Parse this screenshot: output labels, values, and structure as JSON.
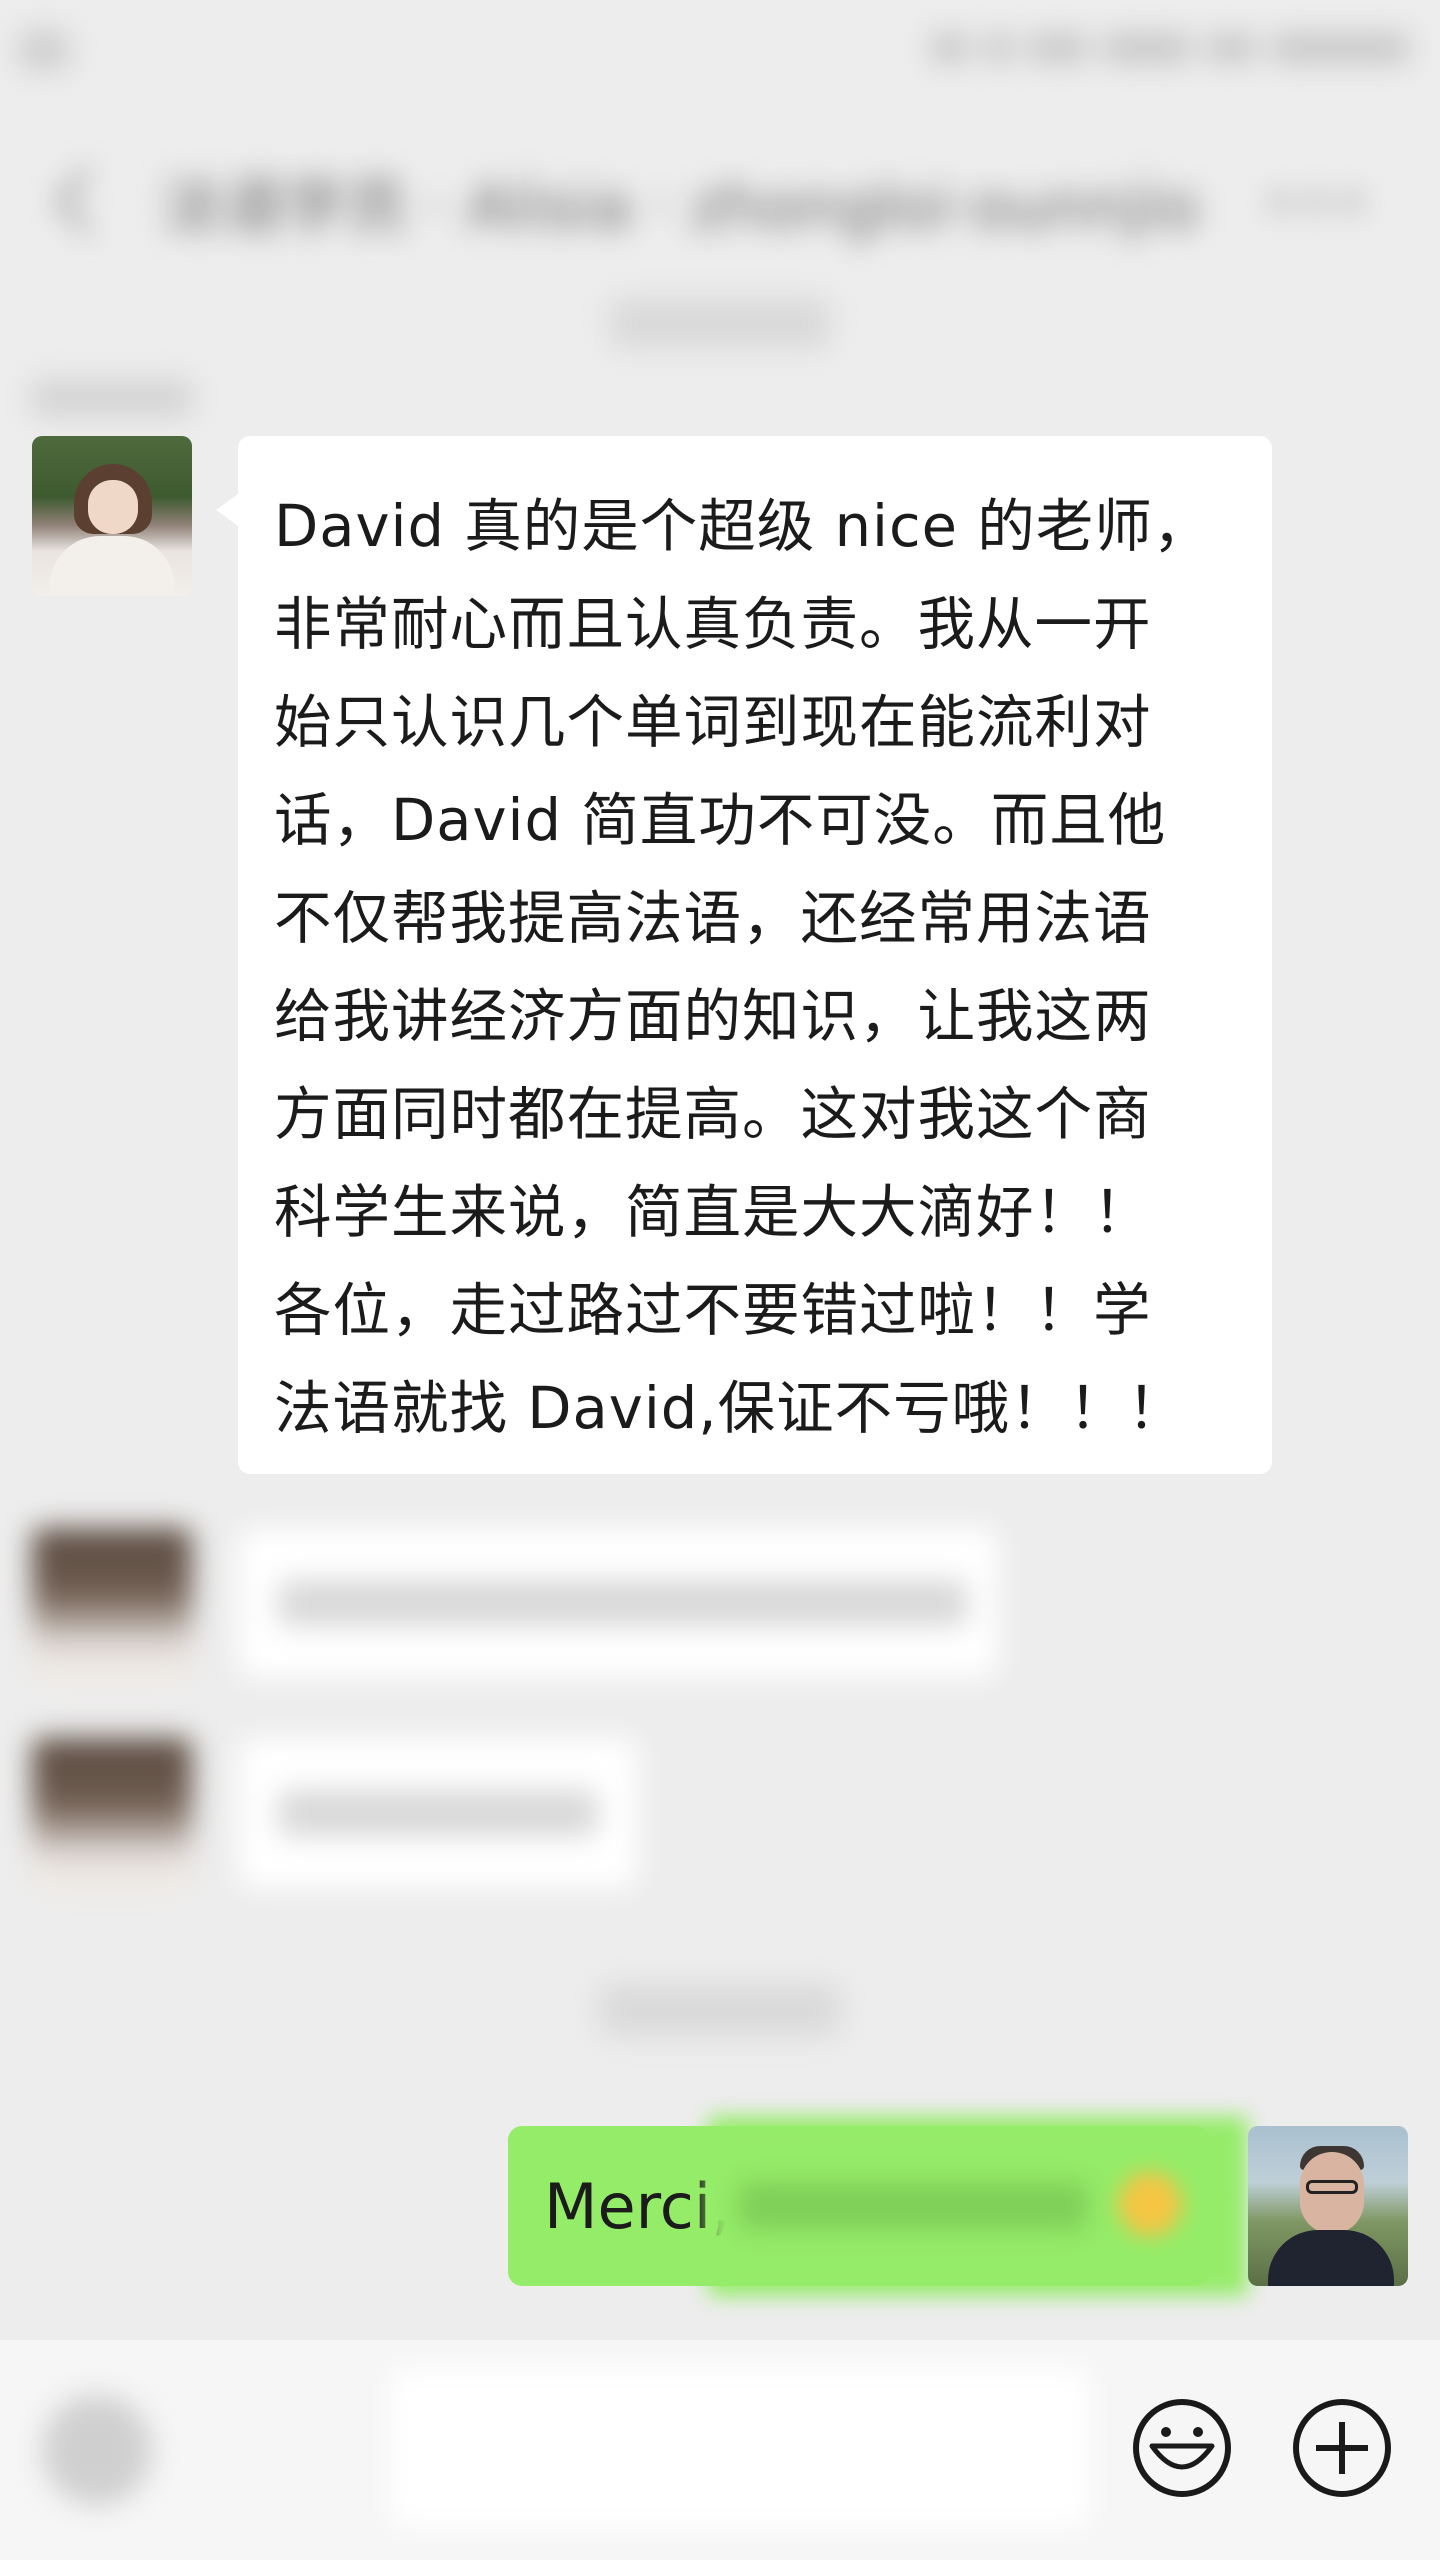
{
  "nav": {
    "title": "法语学员 · Alisia · zhongloi·ounnjio"
  },
  "messages": {
    "main_text": "David 真的是个超级 nice 的老师，\n非常耐心而且认真负责。我从一开\n始只认识几个单词到现在能流利对\n话，David 简直功不可没。而且他\n不仅帮我提高法语，还经常用法语\n给我讲经济方面的知识，让我这两\n方面同时都在提高。这对我这个商\n科学生来说，简直是大大滴好！！\n各位，走过路过不要错过啦！！学\n法语就找 David,保证不亏哦！！！",
    "my_reply": "Merci,"
  },
  "colors": {
    "background": "#ededed",
    "bubble_incoming": "#ffffff",
    "bubble_outgoing": "#95ec69",
    "text": "#1b1b1b"
  },
  "icons": {
    "back": "chevron-left-icon",
    "more": "more-dots-icon",
    "voice": "voice-icon",
    "emoji": "smiley-icon",
    "add": "plus-circle-icon"
  }
}
